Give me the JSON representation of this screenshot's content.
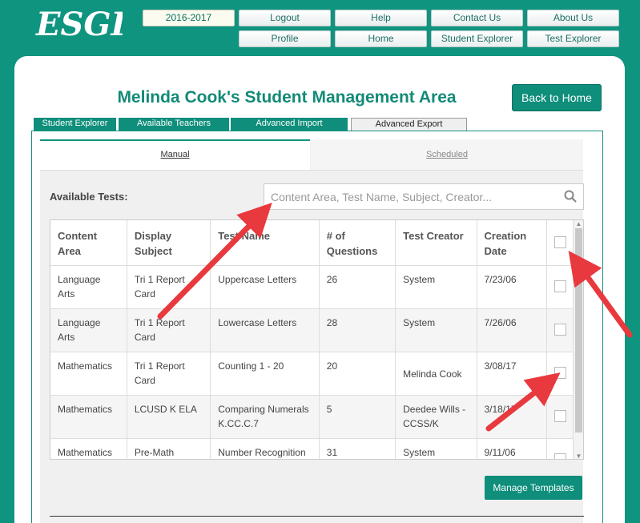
{
  "header": {
    "logo_text": "ESGI",
    "nav_row1": [
      "2016-2017",
      "Logout",
      "Help",
      "Contact Us",
      "About Us"
    ],
    "nav_row2": [
      "Profile",
      "Home",
      "Student Explorer",
      "Test Explorer"
    ]
  },
  "page": {
    "title": "Melinda Cook's Student Management Area",
    "back_home": "Back to Home"
  },
  "tabs": [
    "Student Explorer",
    "Available Teachers",
    "Advanced Import",
    "Advanced Export"
  ],
  "subtabs": {
    "manual": "Manual",
    "scheduled": "Scheduled"
  },
  "tests": {
    "label": "Available Tests:",
    "search_placeholder": "Content Area, Test Name, Subject, Creator...",
    "columns": [
      "Content Area",
      "Display Subject",
      "Test Name",
      "# of Questions",
      "Test Creator",
      "Creation Date"
    ],
    "rows": [
      {
        "area": "Language Arts",
        "subject": "Tri 1 Report Card",
        "name": "Uppercase Letters",
        "questions": "26",
        "creator": "System",
        "date": "7/23/06"
      },
      {
        "area": "Language Arts",
        "subject": "Tri 1 Report Card",
        "name": "Lowercase Letters",
        "questions": "28",
        "creator": "System",
        "date": "7/26/06"
      },
      {
        "area": "Mathematics",
        "subject": "Tri 1 Report Card",
        "name": "Counting 1 - 20",
        "questions": "20",
        "creator": "Melinda Cook",
        "date": "3/08/17"
      },
      {
        "area": "Mathematics",
        "subject": "LCUSD K ELA",
        "name": "Comparing Numerals K.CC.C.7",
        "questions": "5",
        "creator": "Deedee Wills - CCSS/K",
        "date": "3/18/17"
      },
      {
        "area": "Mathematics",
        "subject": "Pre-Math",
        "name": "Number Recognition",
        "questions": "31",
        "creator": "System",
        "date": "9/11/06"
      }
    ]
  },
  "manage_templates": "Manage Templates",
  "colors": {
    "teal": "#0f9480",
    "title": "#138a77",
    "arrow": "#e8393e"
  },
  "icons": [
    "search-icon",
    "annotation-arrow"
  ]
}
